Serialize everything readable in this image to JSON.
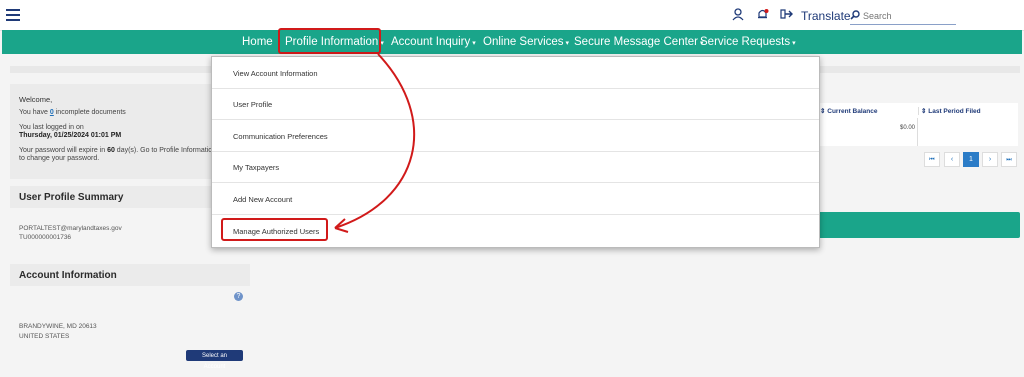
{
  "topbar": {
    "translate_label": "Translate",
    "search_placeholder": "Search",
    "icons": [
      "user-icon",
      "bell-icon",
      "logout-icon",
      "search-icon"
    ]
  },
  "nav": {
    "items": [
      {
        "label": "Home"
      },
      {
        "label": "Profile Information"
      },
      {
        "label": "Account Inquiry"
      },
      {
        "label": "Online Services"
      },
      {
        "label": "Secure Message Center"
      },
      {
        "label": "Service Requests"
      }
    ]
  },
  "dropdown": {
    "items": [
      {
        "label": "View Account Information"
      },
      {
        "label": "User Profile"
      },
      {
        "label": "Communication Preferences"
      },
      {
        "label": "My Taxpayers"
      },
      {
        "label": "Add New Account"
      },
      {
        "label": "Manage Authorized Users"
      }
    ]
  },
  "welcome": {
    "title": "Welcome,",
    "docs_prefix": "You have ",
    "docs_count": "0",
    "docs_suffix": " incomplete documents",
    "last_login_label": "You last logged in on",
    "last_login_value": "Thursday, 01/25/2024 01:01 PM",
    "pw_line1_prefix": "Your password will expire in ",
    "pw_days": "60",
    "pw_line1_suffix": " day(s). Go to Profile Information. U",
    "pw_line2": "to change your password."
  },
  "profile_summary": {
    "title": "User Profile Summary",
    "email": "PORTALTEST@marylandtaxes.gov",
    "user_id": "TU000000001736"
  },
  "account_info": {
    "title": "Account Information",
    "city_line": "BRANDYWINE, MD 20613",
    "country": "UNITED STATES",
    "select_button": "Select an Account"
  },
  "table": {
    "col_current_balance": "Current Balance",
    "col_last_period": "Last Period Filed",
    "balance_value": "$0.00",
    "sort_glyph": "⇕"
  },
  "pager": {
    "first": "⏮",
    "prev": "‹",
    "current": "1",
    "next": "›",
    "last": "⏭"
  },
  "colors": {
    "nav_bg": "#1aa58a",
    "brand_blue": "#1f3a78",
    "highlight_red": "#d11a1a"
  }
}
